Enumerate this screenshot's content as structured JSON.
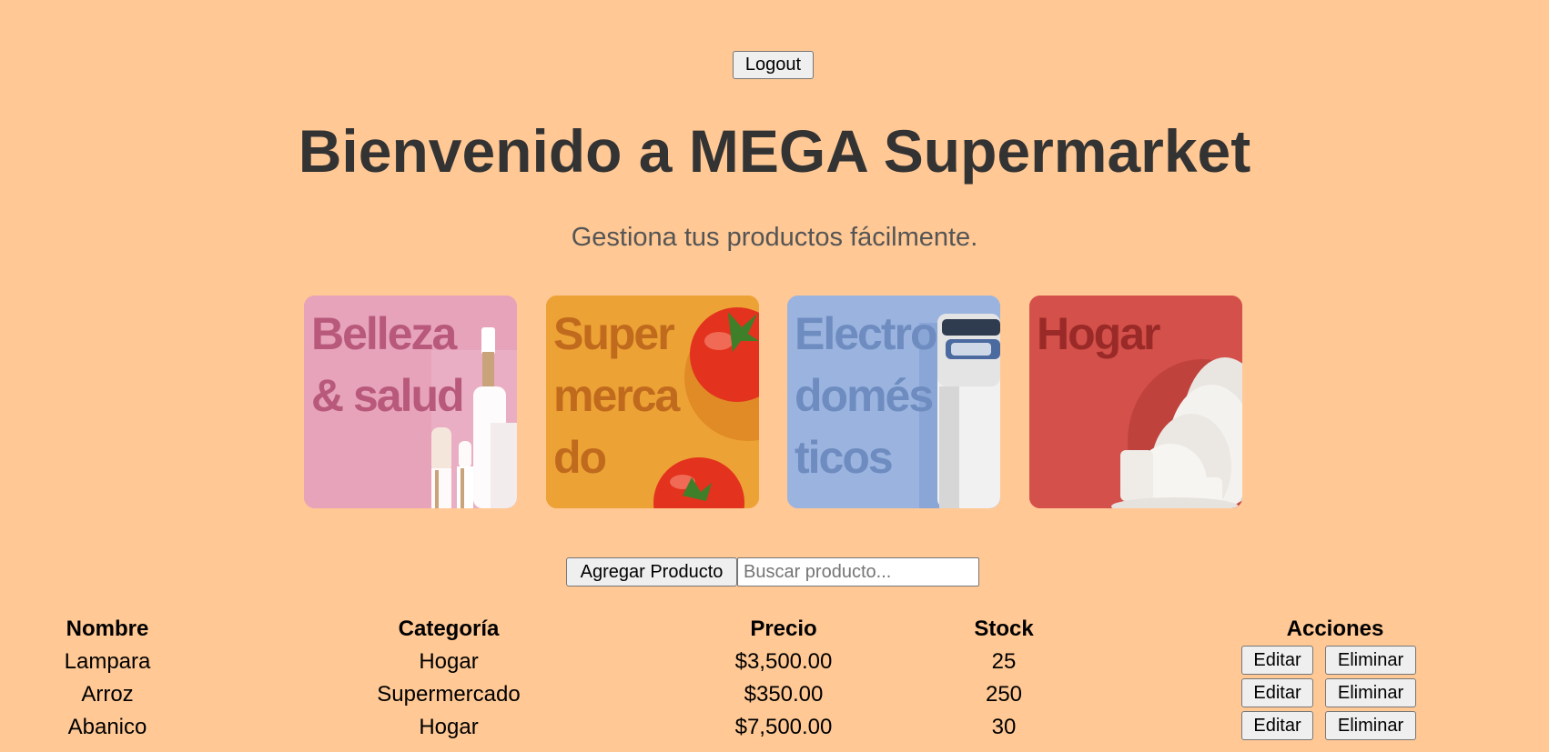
{
  "header": {
    "logout_label": "Logout",
    "title": "Bienvenido a MEGA Supermarket",
    "subtitle": "Gestiona tus productos fácilmente."
  },
  "categories": [
    {
      "lines": [
        "Belleza",
        "& salud"
      ],
      "bg": "#e6a3b9",
      "text_color": "#b8587a"
    },
    {
      "lines": [
        "Super",
        "merca",
        "do"
      ],
      "bg": "#eca235",
      "text_color": "#c06a1e"
    },
    {
      "lines": [
        "Electro",
        "domés",
        "ticos"
      ],
      "bg": "#9ab4df",
      "text_color": "#6e8cc0"
    },
    {
      "lines": [
        "Hogar"
      ],
      "bg": "#d4504a",
      "text_color": "#9a2a28"
    }
  ],
  "toolbar": {
    "add_label": "Agregar Producto",
    "search_placeholder": "Buscar producto..."
  },
  "table": {
    "headers": [
      "Nombre",
      "Categoría",
      "Precio",
      "Stock",
      "Acciones"
    ],
    "rows": [
      {
        "nombre": "Lampara",
        "categoria": "Hogar",
        "precio": "$3,500.00",
        "stock": "25"
      },
      {
        "nombre": "Arroz",
        "categoria": "Supermercado",
        "precio": "$350.00",
        "stock": "250"
      },
      {
        "nombre": "Abanico",
        "categoria": "Hogar",
        "precio": "$7,500.00",
        "stock": "30"
      }
    ],
    "edit_label": "Editar",
    "delete_label": "Eliminar"
  }
}
